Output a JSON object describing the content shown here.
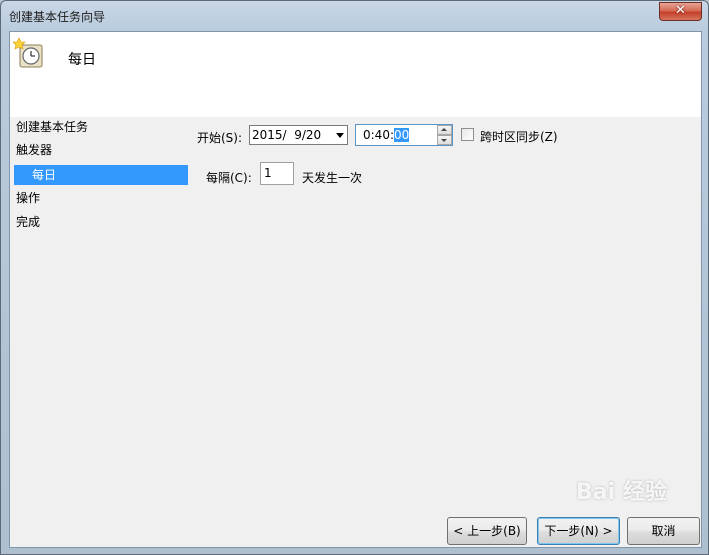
{
  "window": {
    "title": "创建基本任务向导",
    "close_label": "✕"
  },
  "header": {
    "title": "每日",
    "icon": "scheduled-task-clock-icon"
  },
  "nav": {
    "items": [
      {
        "label": "创建基本任务",
        "selected": false
      },
      {
        "label": "触发器",
        "selected": false
      },
      {
        "label": "每日",
        "selected": true
      },
      {
        "label": "操作",
        "selected": false
      },
      {
        "label": "完成",
        "selected": false
      }
    ]
  },
  "form": {
    "start_label": "开始(S):",
    "start_date": "2015/  9/20",
    "start_time_prefix": "0:40:",
    "start_time_selected": "00",
    "timezone_sync_label": "跨时区同步(Z)",
    "timezone_sync_checked": false,
    "recur_label": "每隔(C):",
    "recur_value": "1",
    "recur_unit": "天发生一次"
  },
  "buttons": {
    "back": "< 上一步(B)",
    "next": "下一步(N) >",
    "cancel": "取消"
  },
  "watermark": "Bai 经验",
  "colors": {
    "selection": "#3399ff",
    "close_button": "#c4402b"
  }
}
